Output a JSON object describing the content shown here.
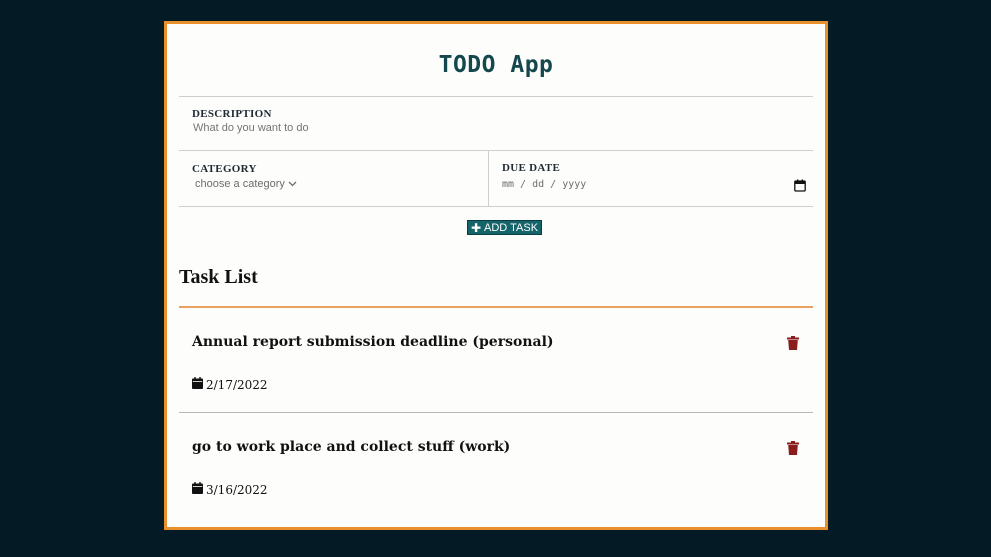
{
  "app": {
    "title": "TODO App"
  },
  "form": {
    "description_label": "DESCRIPTION",
    "description_placeholder": "What do you want to do",
    "category_label": "CATEGORY",
    "category_selected": "choose a category",
    "due_label": "DUE DATE",
    "due_placeholder": "mm / dd / yyyy",
    "add_button": "ADD TASK"
  },
  "task_list": {
    "title": "Task List",
    "tasks": [
      {
        "title": "Annual report submission deadline (personal)",
        "date": "2/17/2022"
      },
      {
        "title": "go to work place and collect stuff (work)",
        "date": "3/16/2022"
      }
    ]
  },
  "colors": {
    "background": "#041a24",
    "card_border": "#e8902c",
    "accent": "#15646a",
    "trash": "#8a1c1c"
  },
  "icons": {
    "category_caret": "chevron-down-icon",
    "date_picker": "calendar-icon",
    "add": "plus-icon",
    "delete": "trash-icon",
    "task_date": "calendar-icon"
  }
}
